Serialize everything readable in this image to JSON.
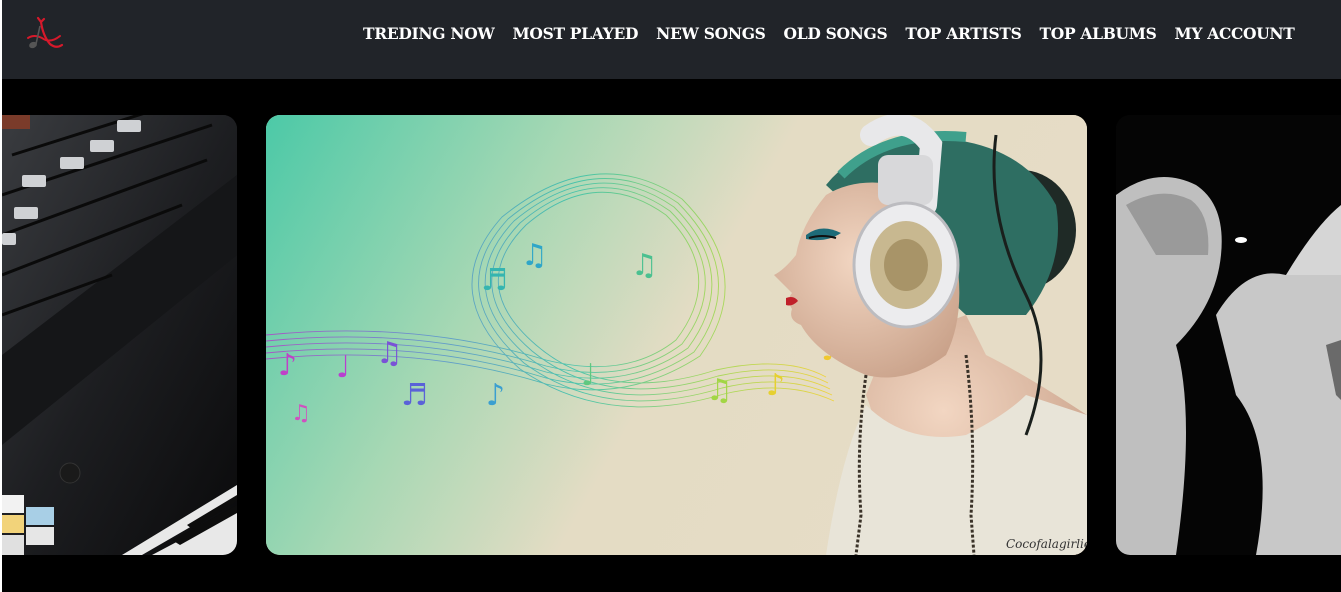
{
  "header": {
    "logo_icon": "music-note-logo-icon",
    "nav": [
      {
        "label": "TREDING NOW"
      },
      {
        "label": "MOST PLAYED"
      },
      {
        "label": "NEW SONGS"
      },
      {
        "label": "OLD SONGS"
      },
      {
        "label": "TOP ARTISTS"
      },
      {
        "label": "TOP ALBUMS"
      },
      {
        "label": "MY ACCOUNT"
      }
    ]
  },
  "carousel": {
    "slides": [
      {
        "image": "mixer-keyboard-image"
      },
      {
        "image": "woman-headphones-music-notes-image",
        "signature": "Cocofalagirlie"
      },
      {
        "image": "concert-crowd-bw-image"
      }
    ]
  },
  "colors": {
    "navbar_bg": "#212429",
    "page_bg": "#000000",
    "nav_text": "#ffffff",
    "logo_red": "#d7192b"
  }
}
